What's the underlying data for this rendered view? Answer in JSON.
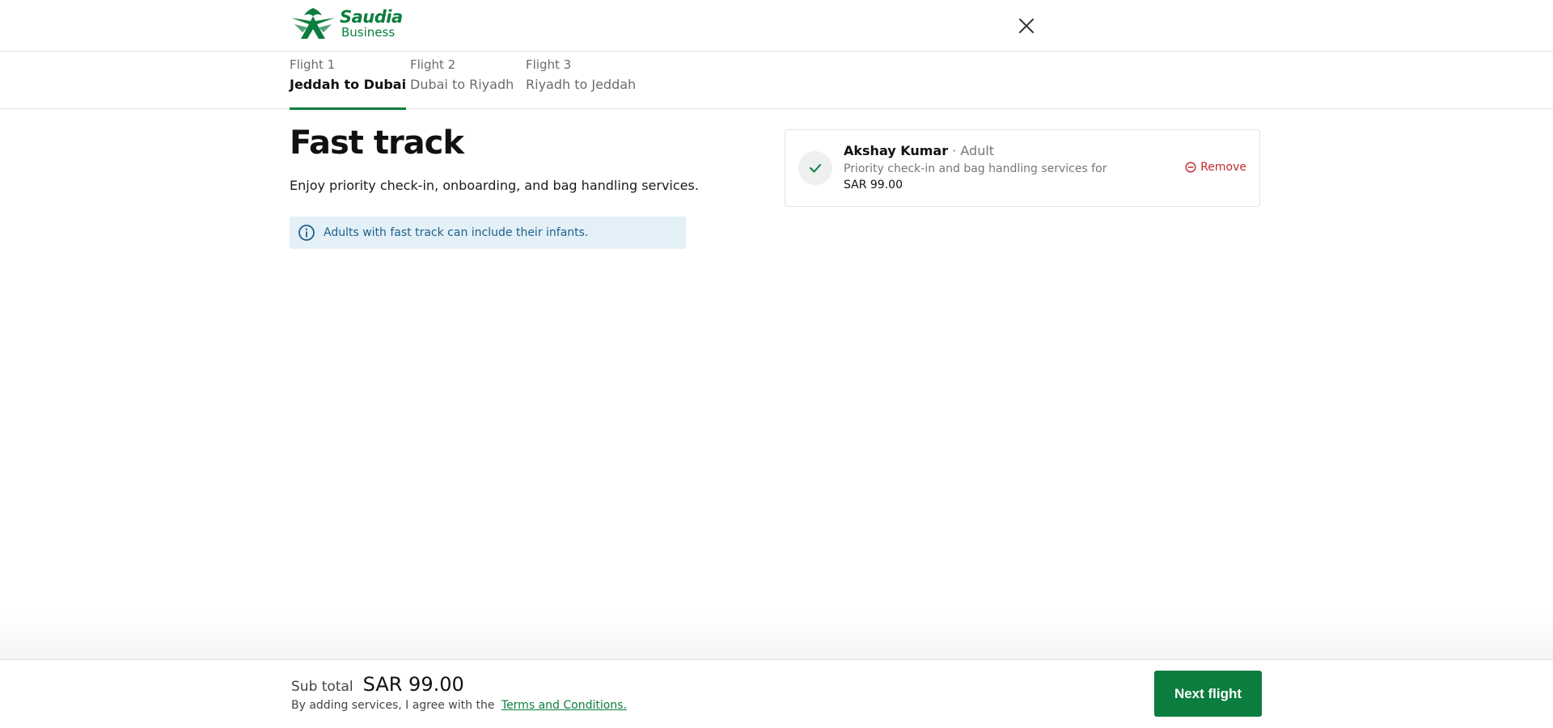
{
  "header": {
    "brand": "Saudia",
    "brand_sub": "Business",
    "logo_icon": "saudia-palm-swords-logo",
    "close_icon": "close-icon"
  },
  "tabs": [
    {
      "label": "Flight 1",
      "route": "Jeddah to Dubai",
      "active": true
    },
    {
      "label": "Flight 2",
      "route": "Dubai to Riyadh",
      "active": false
    },
    {
      "label": "Flight 3",
      "route": "Riyadh to Jeddah",
      "active": false
    }
  ],
  "main": {
    "title": "Fast track",
    "subtitle": "Enjoy priority check-in, onboarding, and bag handling services.",
    "info": "Adults with fast track can include their infants."
  },
  "passenger": {
    "name": "Akshay Kumar",
    "type": " · Adult",
    "description": "Priority check-in and bag handling services for",
    "price": "SAR 99.00",
    "remove_label": "Remove"
  },
  "footer": {
    "subtotal_label": "Sub total",
    "subtotal_value": "SAR 99.00",
    "agree_text": "By adding services, I agree with the",
    "terms_link": "Terms and Conditions.",
    "next_label": "Next flight"
  },
  "colors": {
    "brand_green": "#0b7d3e",
    "info_bg": "#e3f0f8",
    "info_text": "#1e5f8a",
    "remove_red": "#c0292b"
  }
}
